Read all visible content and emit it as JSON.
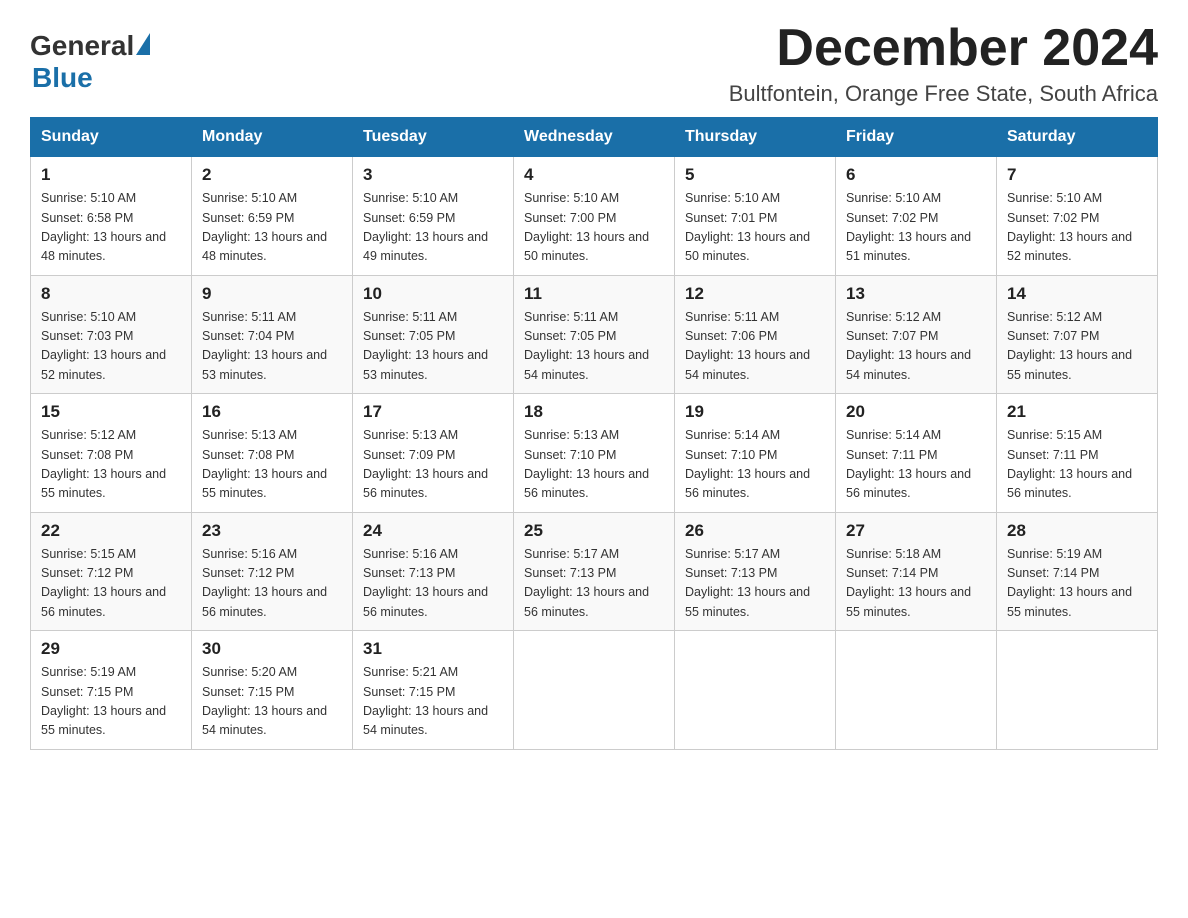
{
  "header": {
    "logo_text1": "General",
    "logo_text2": "Blue",
    "title": "December 2024",
    "subtitle": "Bultfontein, Orange Free State, South Africa"
  },
  "weekdays": [
    "Sunday",
    "Monday",
    "Tuesday",
    "Wednesday",
    "Thursday",
    "Friday",
    "Saturday"
  ],
  "weeks": [
    [
      {
        "day": "1",
        "sunrise": "5:10 AM",
        "sunset": "6:58 PM",
        "daylight": "13 hours and 48 minutes."
      },
      {
        "day": "2",
        "sunrise": "5:10 AM",
        "sunset": "6:59 PM",
        "daylight": "13 hours and 48 minutes."
      },
      {
        "day": "3",
        "sunrise": "5:10 AM",
        "sunset": "6:59 PM",
        "daylight": "13 hours and 49 minutes."
      },
      {
        "day": "4",
        "sunrise": "5:10 AM",
        "sunset": "7:00 PM",
        "daylight": "13 hours and 50 minutes."
      },
      {
        "day": "5",
        "sunrise": "5:10 AM",
        "sunset": "7:01 PM",
        "daylight": "13 hours and 50 minutes."
      },
      {
        "day": "6",
        "sunrise": "5:10 AM",
        "sunset": "7:02 PM",
        "daylight": "13 hours and 51 minutes."
      },
      {
        "day": "7",
        "sunrise": "5:10 AM",
        "sunset": "7:02 PM",
        "daylight": "13 hours and 52 minutes."
      }
    ],
    [
      {
        "day": "8",
        "sunrise": "5:10 AM",
        "sunset": "7:03 PM",
        "daylight": "13 hours and 52 minutes."
      },
      {
        "day": "9",
        "sunrise": "5:11 AM",
        "sunset": "7:04 PM",
        "daylight": "13 hours and 53 minutes."
      },
      {
        "day": "10",
        "sunrise": "5:11 AM",
        "sunset": "7:05 PM",
        "daylight": "13 hours and 53 minutes."
      },
      {
        "day": "11",
        "sunrise": "5:11 AM",
        "sunset": "7:05 PM",
        "daylight": "13 hours and 54 minutes."
      },
      {
        "day": "12",
        "sunrise": "5:11 AM",
        "sunset": "7:06 PM",
        "daylight": "13 hours and 54 minutes."
      },
      {
        "day": "13",
        "sunrise": "5:12 AM",
        "sunset": "7:07 PM",
        "daylight": "13 hours and 54 minutes."
      },
      {
        "day": "14",
        "sunrise": "5:12 AM",
        "sunset": "7:07 PM",
        "daylight": "13 hours and 55 minutes."
      }
    ],
    [
      {
        "day": "15",
        "sunrise": "5:12 AM",
        "sunset": "7:08 PM",
        "daylight": "13 hours and 55 minutes."
      },
      {
        "day": "16",
        "sunrise": "5:13 AM",
        "sunset": "7:08 PM",
        "daylight": "13 hours and 55 minutes."
      },
      {
        "day": "17",
        "sunrise": "5:13 AM",
        "sunset": "7:09 PM",
        "daylight": "13 hours and 56 minutes."
      },
      {
        "day": "18",
        "sunrise": "5:13 AM",
        "sunset": "7:10 PM",
        "daylight": "13 hours and 56 minutes."
      },
      {
        "day": "19",
        "sunrise": "5:14 AM",
        "sunset": "7:10 PM",
        "daylight": "13 hours and 56 minutes."
      },
      {
        "day": "20",
        "sunrise": "5:14 AM",
        "sunset": "7:11 PM",
        "daylight": "13 hours and 56 minutes."
      },
      {
        "day": "21",
        "sunrise": "5:15 AM",
        "sunset": "7:11 PM",
        "daylight": "13 hours and 56 minutes."
      }
    ],
    [
      {
        "day": "22",
        "sunrise": "5:15 AM",
        "sunset": "7:12 PM",
        "daylight": "13 hours and 56 minutes."
      },
      {
        "day": "23",
        "sunrise": "5:16 AM",
        "sunset": "7:12 PM",
        "daylight": "13 hours and 56 minutes."
      },
      {
        "day": "24",
        "sunrise": "5:16 AM",
        "sunset": "7:13 PM",
        "daylight": "13 hours and 56 minutes."
      },
      {
        "day": "25",
        "sunrise": "5:17 AM",
        "sunset": "7:13 PM",
        "daylight": "13 hours and 56 minutes."
      },
      {
        "day": "26",
        "sunrise": "5:17 AM",
        "sunset": "7:13 PM",
        "daylight": "13 hours and 55 minutes."
      },
      {
        "day": "27",
        "sunrise": "5:18 AM",
        "sunset": "7:14 PM",
        "daylight": "13 hours and 55 minutes."
      },
      {
        "day": "28",
        "sunrise": "5:19 AM",
        "sunset": "7:14 PM",
        "daylight": "13 hours and 55 minutes."
      }
    ],
    [
      {
        "day": "29",
        "sunrise": "5:19 AM",
        "sunset": "7:15 PM",
        "daylight": "13 hours and 55 minutes."
      },
      {
        "day": "30",
        "sunrise": "5:20 AM",
        "sunset": "7:15 PM",
        "daylight": "13 hours and 54 minutes."
      },
      {
        "day": "31",
        "sunrise": "5:21 AM",
        "sunset": "7:15 PM",
        "daylight": "13 hours and 54 minutes."
      },
      null,
      null,
      null,
      null
    ]
  ]
}
